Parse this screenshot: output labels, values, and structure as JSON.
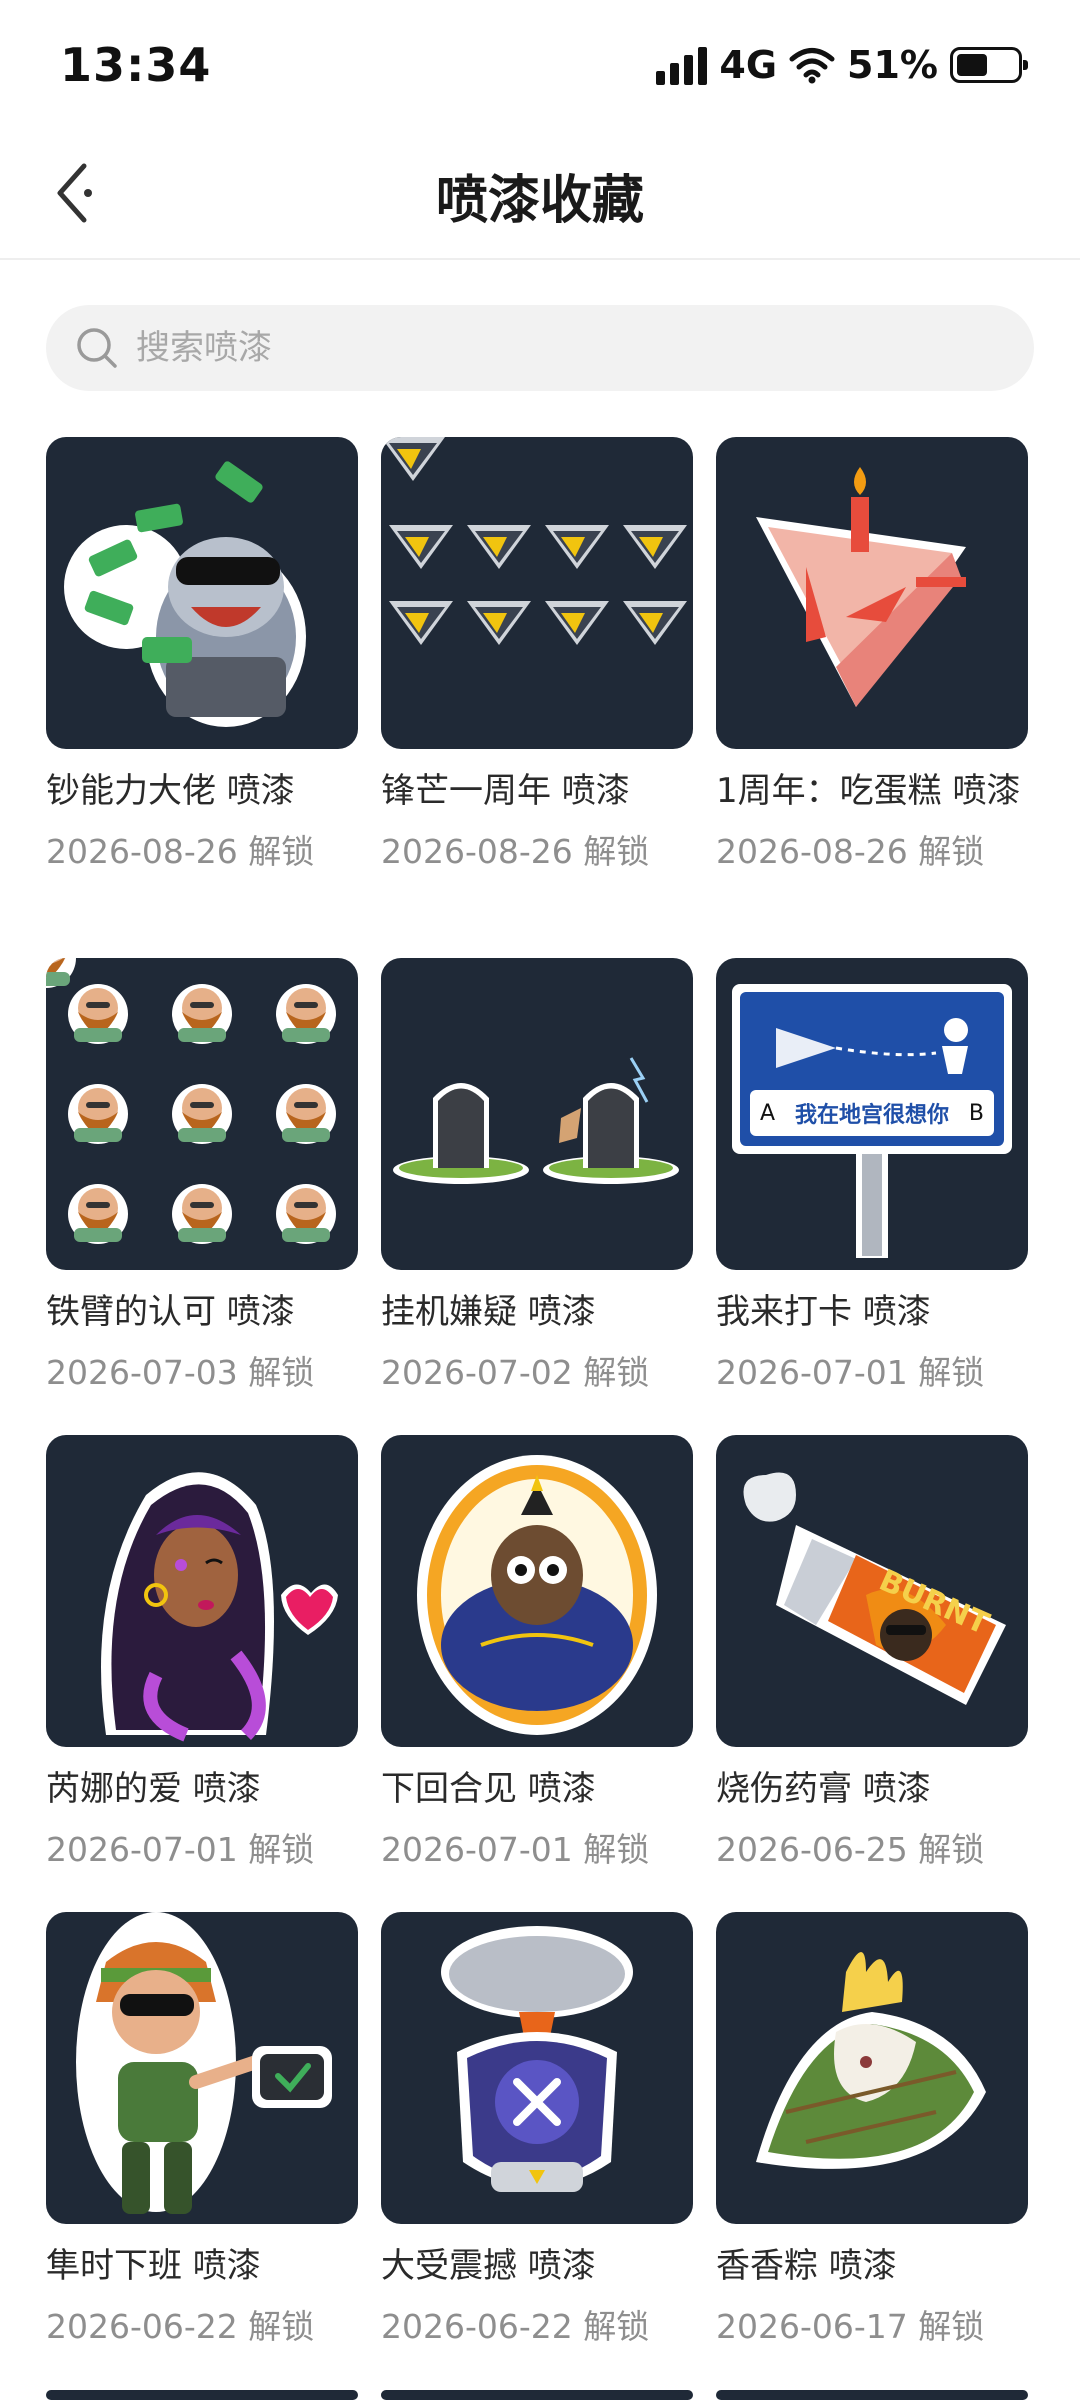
{
  "status": {
    "time": "13:34",
    "network": "4G",
    "battery_pct": "51%",
    "battery_level": 0.51,
    "icons": [
      "signal-icon",
      "wifi-icon",
      "battery-icon"
    ]
  },
  "header": {
    "title": "喷漆收藏",
    "back_icon": "back-arrow-icon"
  },
  "search": {
    "placeholder": "搜索喷漆",
    "icon": "search-icon"
  },
  "theme": {
    "card_bg": "#1f2937",
    "accent_gray": "#8e8e8e"
  },
  "sprays": [
    {
      "title": "钞能力大佬 喷漆",
      "date": "2026-08-26 解锁"
    },
    {
      "title": "锋芒一周年 喷漆",
      "date": "2026-08-26 解锁"
    },
    {
      "title": "1周年：吃蛋糕 喷漆",
      "date": "2026-08-26 解锁"
    },
    {
      "title": "铁臂的认可 喷漆",
      "date": "2026-07-03 解锁"
    },
    {
      "title": "挂机嫌疑 喷漆",
      "date": "2026-07-02 解锁"
    },
    {
      "title": "我来打卡 喷漆",
      "date": "2026-07-01 解锁",
      "sign_text": "我在地宫很想你",
      "sign_left": "A",
      "sign_right": "B"
    },
    {
      "title": "芮娜的爱 喷漆",
      "date": "2026-07-01 解锁"
    },
    {
      "title": "下回合见 喷漆",
      "date": "2026-07-01 解锁"
    },
    {
      "title": "烧伤药膏 喷漆",
      "date": "2026-06-25 解锁",
      "label_text": "BURNT"
    },
    {
      "title": "隼时下班 喷漆",
      "date": "2026-06-22 解锁"
    },
    {
      "title": "大受震撼 喷漆",
      "date": "2026-06-22 解锁"
    },
    {
      "title": "香香粽 喷漆",
      "date": "2026-06-17 解锁"
    }
  ]
}
